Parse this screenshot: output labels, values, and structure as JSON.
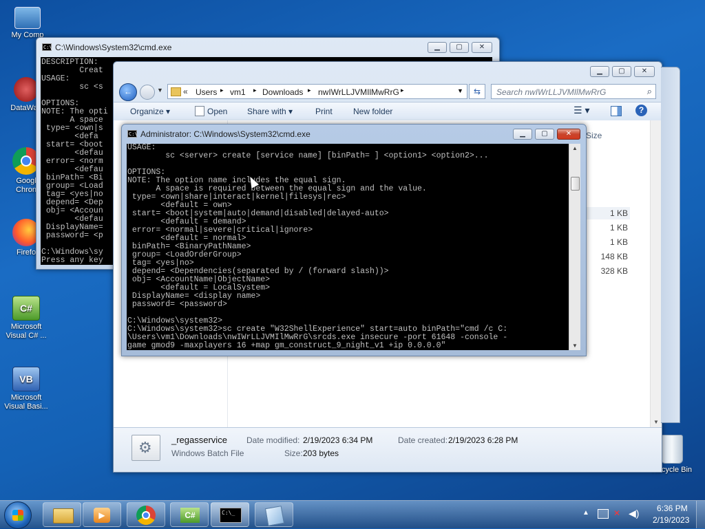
{
  "desktop": {
    "icons": [
      {
        "label": "My Comp"
      },
      {
        "label": "DataWag"
      },
      {
        "label": "Googl Chron"
      },
      {
        "label": "Firefo"
      },
      {
        "label": "Microsoft Visual C# ..."
      },
      {
        "label": "Microsoft Visual Basi..."
      },
      {
        "label": "Recycle Bin"
      }
    ]
  },
  "back_cmd": {
    "title": "C:\\Windows\\System32\\cmd.exe",
    "lines": [
      "DESCRIPTION:",
      "        Creat",
      "USAGE:",
      "        sc <s",
      "",
      "OPTIONS:",
      "NOTE: The opti",
      "      A space",
      " type= <own|s",
      "       <defa",
      " start= <boot",
      "       <defau",
      " error= <norm",
      "       <defau",
      " binPath= <Bi",
      " group= <Load",
      " tag= <yes|no",
      " depend= <Dep",
      " obj= <Accoun",
      "       <defau",
      " DisplayName=",
      " password= <p",
      "",
      "C:\\Windows\\sy",
      "Press any key"
    ]
  },
  "explorer": {
    "breadcrumb": [
      "Users",
      "vm1",
      "Downloads",
      "nwIWrLLJVMIlMwRrG"
    ],
    "search_placeholder": "Search nwIWrLLJVMIlMwRrG",
    "toolbar": {
      "organize": "Organize ▾",
      "open": "Open",
      "share": "Share with ▾",
      "print": "Print",
      "new_folder": "New folder"
    },
    "size_header": "Size",
    "sizes": [
      "1 KB",
      "1 KB",
      "1 KB",
      "148 KB",
      "328 KB"
    ],
    "details": {
      "name": "_regasservice",
      "type": "Windows Batch File",
      "modified_label": "Date modified:",
      "modified_value": "2/19/2023 6:34 PM",
      "created_label": "Date created:",
      "created_value": "2/19/2023 6:28 PM",
      "size_label": "Size:",
      "size_value": "203 bytes"
    }
  },
  "front_cmd": {
    "title": "Administrator: C:\\Windows\\System32\\cmd.exe",
    "lines": [
      "USAGE:",
      "        sc <server> create [service name] [binPath= ] <option1> <option2>...",
      "",
      "OPTIONS:",
      "NOTE: The option name includes the equal sign.",
      "      A space is required between the equal sign and the value.",
      " type= <own|share|interact|kernel|filesys|rec>",
      "       <default = own>",
      " start= <boot|system|auto|demand|disabled|delayed-auto>",
      "       <default = demand>",
      " error= <normal|severe|critical|ignore>",
      "       <default = normal>",
      " binPath= <BinaryPathName>",
      " group= <LoadOrderGroup>",
      " tag= <yes|no>",
      " depend= <Dependencies(separated by / (forward slash))>",
      " obj= <AccountName|ObjectName>",
      "       <default = LocalSystem>",
      " DisplayName= <display name>",
      " password= <password>",
      "",
      "C:\\Windows\\system32>",
      "C:\\Windows\\system32>sc create \"W32ShellExperience\" start=auto binPath=\"cmd /c C:",
      "\\Users\\vm1\\Downloads\\nwIWrLLJVMIlMwRrG\\srcds.exe insecure -port 61648 -console -",
      "game gmod9 -maxplayers 16 +map gm_construct_9_night_v1 +ip 0.0.0.0\""
    ]
  },
  "taskbar": {
    "time": "6:36 PM",
    "date": "2/19/2023",
    "cmd_icon_text": "C:\\_",
    "csharp_text": "C#"
  }
}
